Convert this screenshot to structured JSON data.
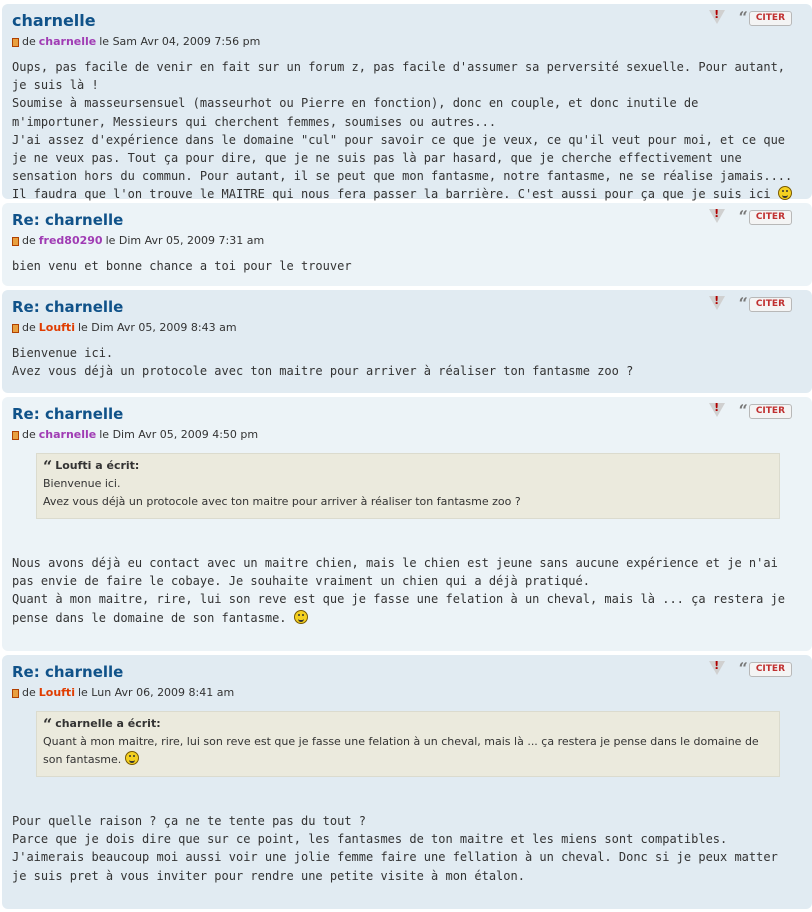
{
  "buttons": {
    "report_glyph": "!",
    "quote_glyph": "“",
    "quote_label": "CITER"
  },
  "icons": {
    "post": "post-icon",
    "report": "report-warning-icon",
    "quote": "quote-icon",
    "smiley": "smiley-icon"
  },
  "colors": {
    "post_bg_dark": "#e1ebf2",
    "post_bg_light": "#ecf3f7",
    "title": "#105289",
    "user_purple": "#a03cb4",
    "user_red": "#e03c00",
    "quote_bg": "#ebeadd"
  },
  "posts": [
    {
      "title": "charnelle",
      "by": "de",
      "author": "charnelle",
      "date": "le Sam Avr 04, 2009 7:56 pm",
      "lines": [
        "Oups, pas facile de venir en fait sur un forum z, pas facile d'assumer sa perversité sexuelle. Pour autant, je suis là !",
        "Soumise à masseursensuel (masseurhot ou Pierre en fonction), donc en couple, et donc inutile de m'importuner, Messieurs qui cherchent femmes, soumises ou autres...",
        "J'ai assez d'expérience dans le domaine \"cul\" pour savoir ce que je veux, ce qu'il veut pour moi, et ce que je ne veux pas. Tout ça pour dire, que je ne suis pas là par hasard, que je cherche effectivement une sensation hors du commun. Pour autant, il se peut que mon fantasme, notre fantasme, ne se réalise jamais....",
        "Il faudra que l'on trouve le MAITRE qui nous fera passer la barrière. C'est aussi pour ça que je suis ici"
      ]
    },
    {
      "title": "Re: charnelle",
      "by": "de",
      "author": "fred80290",
      "date": "le Dim Avr 05, 2009 7:31 am",
      "lines": [
        "bien venu et bonne chance a toi pour le trouver"
      ]
    },
    {
      "title": "Re: charnelle",
      "by": "de",
      "author": "Loufti",
      "date": "le Dim Avr 05, 2009 8:43 am",
      "lines": [
        "Bienvenue ici.",
        "Avez vous déjà un protocole avec ton maitre pour arriver à réaliser ton fantasme zoo ?"
      ]
    },
    {
      "title": "Re: charnelle",
      "by": "de",
      "author": "charnelle",
      "date": "le Dim Avr 05, 2009 4:50 pm",
      "quote": {
        "cite": "Loufti a écrit:",
        "lines": [
          "Bienvenue ici.",
          "Avez vous déjà un protocole avec ton maitre pour arriver à réaliser ton fantasme zoo ?"
        ]
      },
      "lines": [
        "Nous avons déjà eu contact avec un maitre chien, mais le chien est jeune sans aucune expérience et je n'ai pas envie de faire le cobaye. Je souhaite vraiment un chien qui a déjà pratiqué.",
        "Quant à mon maitre, rire, lui son reve est que je fasse une felation à un cheval, mais là ... ça restera je pense dans le domaine de son fantasme."
      ]
    },
    {
      "title": "Re: charnelle",
      "by": "de",
      "author": "Loufti",
      "date": "le Lun Avr 06, 2009 8:41 am",
      "quote": {
        "cite": "charnelle a écrit:",
        "lines": [
          "Quant à mon maitre, rire, lui son reve est que je fasse une felation à un cheval, mais là ... ça restera je pense dans le domaine de son fantasme."
        ]
      },
      "lines": [
        "Pour quelle raison ? ça ne te tente pas du tout ?",
        "Parce que je dois dire que sur ce point, les fantasmes de ton maitre et les miens sont compatibles. J'aimerais beaucoup moi aussi voir une jolie femme faire une fellation à un cheval. Donc si je peux matter je suis pret à vous inviter pour rendre une petite visite à mon étalon."
      ]
    }
  ]
}
